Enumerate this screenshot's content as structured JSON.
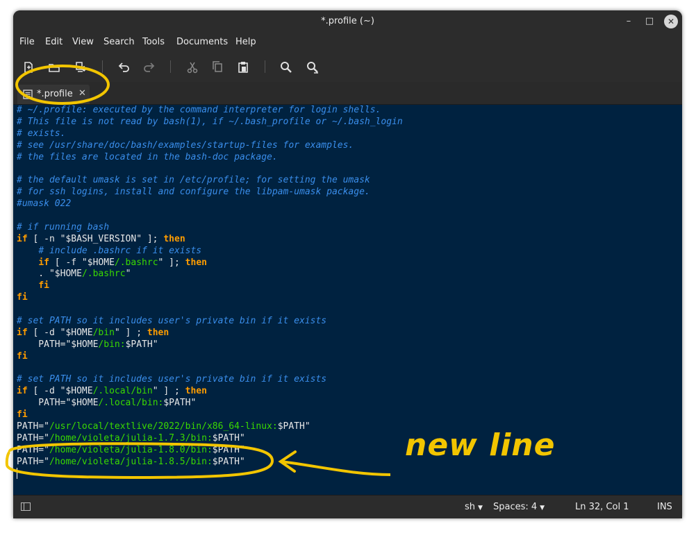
{
  "window": {
    "title": "*.profile (~)"
  },
  "window_controls": {
    "minimize": "–",
    "maximize": "□",
    "close": "✕"
  },
  "menu": [
    "File",
    "Edit",
    "View",
    "Search",
    "Tools",
    "Documents",
    "Help"
  ],
  "toolbar": {
    "icons": [
      "new-document-icon",
      "open-folder-icon",
      "save-icon",
      "undo-icon",
      "redo-icon",
      "cut-icon",
      "copy-icon",
      "paste-icon",
      "search-icon",
      "search-replace-icon"
    ]
  },
  "tab": {
    "label": "*.profile",
    "close": "✕"
  },
  "editor": {
    "lines": [
      [
        [
          "cm",
          "# ~/.profile: executed by the command interpreter for login shells."
        ]
      ],
      [
        [
          "cm",
          "# This file is not read by bash(1), if ~/.bash_profile or ~/.bash_login"
        ]
      ],
      [
        [
          "cm",
          "# exists."
        ]
      ],
      [
        [
          "cm",
          "# see /usr/share/doc/bash/examples/startup-files for examples."
        ]
      ],
      [
        [
          "cm",
          "# the files are located in the bash-doc package."
        ]
      ],
      [],
      [
        [
          "cm",
          "# the default umask is set in /etc/profile; for setting the umask"
        ]
      ],
      [
        [
          "cm",
          "# for ssh logins, install and configure the libpam-umask package."
        ]
      ],
      [
        [
          "cm",
          "#umask 022"
        ]
      ],
      [],
      [
        [
          "cm",
          "# if running bash"
        ]
      ],
      [
        [
          "kw",
          "if"
        ],
        [
          "pl",
          " [ -n \""
        ],
        [
          "pl",
          "$BASH_VERSION"
        ],
        [
          "pl",
          "\" ]; "
        ],
        [
          "kw",
          "then"
        ]
      ],
      [
        [
          "pl",
          "    "
        ],
        [
          "cm",
          "# include .bashrc if it exists"
        ]
      ],
      [
        [
          "pl",
          "    "
        ],
        [
          "kw",
          "if"
        ],
        [
          "pl",
          " [ -f \""
        ],
        [
          "pl",
          "$HOME"
        ],
        [
          "st",
          "/.bashrc"
        ],
        [
          "pl",
          "\" ]; "
        ],
        [
          "kw",
          "then"
        ]
      ],
      [
        [
          "pl",
          "    . \""
        ],
        [
          "pl",
          "$HOME"
        ],
        [
          "st",
          "/.bashrc"
        ],
        [
          "pl",
          "\""
        ]
      ],
      [
        [
          "pl",
          "    "
        ],
        [
          "kw",
          "fi"
        ]
      ],
      [
        [
          "kw",
          "fi"
        ]
      ],
      [],
      [
        [
          "cm",
          "# set PATH so it includes user's private bin if it exists"
        ]
      ],
      [
        [
          "kw",
          "if"
        ],
        [
          "pl",
          " [ -d \""
        ],
        [
          "pl",
          "$HOME"
        ],
        [
          "st",
          "/bin"
        ],
        [
          "pl",
          "\" ] ; "
        ],
        [
          "kw",
          "then"
        ]
      ],
      [
        [
          "pl",
          "    PATH=\""
        ],
        [
          "pl",
          "$HOME"
        ],
        [
          "st",
          "/bin:"
        ],
        [
          "pl",
          "$PATH"
        ],
        [
          "pl",
          "\""
        ]
      ],
      [
        [
          "kw",
          "fi"
        ]
      ],
      [],
      [
        [
          "cm",
          "# set PATH so it includes user's private bin if it exists"
        ]
      ],
      [
        [
          "kw",
          "if"
        ],
        [
          "pl",
          " [ -d \""
        ],
        [
          "pl",
          "$HOME"
        ],
        [
          "st",
          "/.local/bin"
        ],
        [
          "pl",
          "\" ] ; "
        ],
        [
          "kw",
          "then"
        ]
      ],
      [
        [
          "pl",
          "    PATH=\""
        ],
        [
          "pl",
          "$HOME"
        ],
        [
          "st",
          "/.local/bin:"
        ],
        [
          "pl",
          "$PATH"
        ],
        [
          "pl",
          "\""
        ]
      ],
      [
        [
          "kw",
          "fi"
        ]
      ],
      [
        [
          "pl",
          "PATH=\""
        ],
        [
          "st",
          "/usr/local/textlive/2022/bin/x86_64-linux:"
        ],
        [
          "pl",
          "$PATH"
        ],
        [
          "pl",
          "\""
        ]
      ],
      [
        [
          "pl",
          "PATH=\""
        ],
        [
          "st",
          "/home/violeta/julia-1.7.3/bin:"
        ],
        [
          "pl",
          "$PATH"
        ],
        [
          "pl",
          "\""
        ]
      ],
      [
        [
          "pl",
          "PATH=\""
        ],
        [
          "st",
          "/home/violeta/julia-1.8.0/bin:"
        ],
        [
          "pl",
          "$PATH"
        ],
        [
          "pl",
          "\""
        ]
      ],
      [
        [
          "pl",
          "PATH=\""
        ],
        [
          "st",
          "/home/violeta/julia-1.8.5/bin:"
        ],
        [
          "pl",
          "$PATH"
        ],
        [
          "pl",
          "\""
        ]
      ],
      []
    ]
  },
  "statusbar": {
    "language": "sh",
    "spaces": "Spaces: 4",
    "position": "Ln 32, Col 1",
    "mode": "INS"
  },
  "annotation": {
    "text": "new line",
    "color": "#f2c500"
  }
}
